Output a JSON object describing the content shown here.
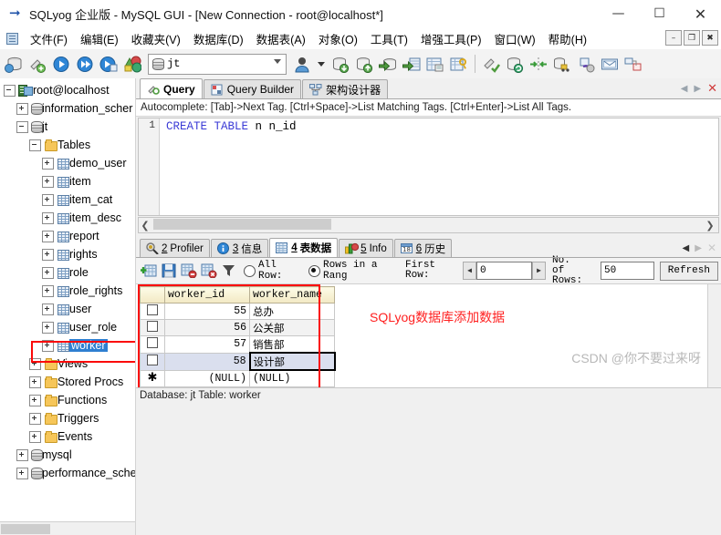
{
  "window": {
    "title": "SQLyog 企业版 - MySQL GUI - [New Connection - root@localhost*]",
    "app_icon": "sqlyog-icon",
    "minimize": "—",
    "maximize": "☐",
    "close": "✕",
    "mdi_minimize": "–",
    "mdi_restore": "❐",
    "mdi_close": "✖"
  },
  "menubar": {
    "items": [
      {
        "label": "文件(F)"
      },
      {
        "label": "编辑(E)"
      },
      {
        "label": "收藏夹(V)"
      },
      {
        "label": "数据库(D)"
      },
      {
        "label": "数据表(A)"
      },
      {
        "label": "对象(O)"
      },
      {
        "label": "工具(T)"
      },
      {
        "label": "增强工具(P)"
      },
      {
        "label": "窗口(W)"
      },
      {
        "label": "帮助(H)"
      }
    ]
  },
  "toolbar": {
    "database_selector": {
      "value": "jt",
      "icon": "database-icon"
    }
  },
  "sidebar": {
    "items": [
      {
        "label": "root@localhost",
        "indent": 0,
        "expander": "minus",
        "icon": "server-icon",
        "selected": false
      },
      {
        "label": "information_scher",
        "indent": 1,
        "expander": "plus",
        "icon": "database-icon",
        "selected": false
      },
      {
        "label": "jt",
        "indent": 1,
        "expander": "minus",
        "icon": "database-icon",
        "selected": false
      },
      {
        "label": "Tables",
        "indent": 2,
        "expander": "minus",
        "icon": "folder-icon",
        "selected": false
      },
      {
        "label": "demo_user",
        "indent": 3,
        "expander": "plus",
        "icon": "table-icon",
        "selected": false
      },
      {
        "label": "item",
        "indent": 3,
        "expander": "plus",
        "icon": "table-icon",
        "selected": false
      },
      {
        "label": "item_cat",
        "indent": 3,
        "expander": "plus",
        "icon": "table-icon",
        "selected": false
      },
      {
        "label": "item_desc",
        "indent": 3,
        "expander": "plus",
        "icon": "table-icon",
        "selected": false
      },
      {
        "label": "report",
        "indent": 3,
        "expander": "plus",
        "icon": "table-icon",
        "selected": false
      },
      {
        "label": "rights",
        "indent": 3,
        "expander": "plus",
        "icon": "table-icon",
        "selected": false
      },
      {
        "label": "role",
        "indent": 3,
        "expander": "plus",
        "icon": "table-icon",
        "selected": false
      },
      {
        "label": "role_rights",
        "indent": 3,
        "expander": "plus",
        "icon": "table-icon",
        "selected": false
      },
      {
        "label": "user",
        "indent": 3,
        "expander": "plus",
        "icon": "table-icon",
        "selected": false
      },
      {
        "label": "user_role",
        "indent": 3,
        "expander": "plus",
        "icon": "table-icon",
        "selected": false
      },
      {
        "label": "worker",
        "indent": 3,
        "expander": "plus",
        "icon": "table-icon",
        "selected": true
      },
      {
        "label": "Views",
        "indent": 2,
        "expander": "plus",
        "icon": "folder-icon",
        "selected": false
      },
      {
        "label": "Stored Procs",
        "indent": 2,
        "expander": "plus",
        "icon": "folder-icon",
        "selected": false
      },
      {
        "label": "Functions",
        "indent": 2,
        "expander": "plus",
        "icon": "folder-icon",
        "selected": false
      },
      {
        "label": "Triggers",
        "indent": 2,
        "expander": "plus",
        "icon": "folder-icon",
        "selected": false
      },
      {
        "label": "Events",
        "indent": 2,
        "expander": "plus",
        "icon": "folder-icon",
        "selected": false
      },
      {
        "label": "mysql",
        "indent": 1,
        "expander": "plus",
        "icon": "database-icon",
        "selected": false
      },
      {
        "label": "performance_sche",
        "indent": 1,
        "expander": "plus",
        "icon": "database-icon",
        "selected": false
      }
    ]
  },
  "query_tabs": {
    "tabs": [
      {
        "label": "Query",
        "icon": "query-icon",
        "active": true
      },
      {
        "label": "Query Builder",
        "icon": "query-builder-icon",
        "active": false
      },
      {
        "label": "架构设计器",
        "icon": "schema-designer-icon",
        "active": false
      }
    ],
    "close_label": "✕"
  },
  "editor": {
    "autocomplete_hint": "Autocomplete: [Tab]->Next Tag. [Ctrl+Space]->List Matching Tags. [Ctrl+Enter]->List All Tags.",
    "line_number": "1",
    "code_keyword": "CREATE TABLE",
    "code_rest": " n n_id"
  },
  "result_tabs": {
    "tabs": [
      {
        "num": "2",
        "label": "Profiler",
        "icon": "profiler-icon",
        "active": false
      },
      {
        "num": "3",
        "label": "信息",
        "icon": "info-blue-icon",
        "active": false
      },
      {
        "num": "4",
        "label": "表数据",
        "icon": "table-data-icon",
        "active": true
      },
      {
        "num": "5",
        "label": "Info",
        "icon": "chart-icon",
        "active": false
      },
      {
        "num": "6",
        "label": "历史",
        "icon": "calendar-icon",
        "active": false
      }
    ]
  },
  "grid_toolbar": {
    "icons": [
      {
        "name": "new-row-icon"
      },
      {
        "name": "save-icon"
      },
      {
        "name": "delete-row-icon"
      },
      {
        "name": "discard-changes-icon"
      },
      {
        "name": "filter-icon"
      }
    ],
    "all_rows_label": "All Row:",
    "range_label": "Rows in a Rang",
    "first_row_label_1": "First",
    "first_row_label_2": "Row:",
    "first_row_value": "0",
    "no_of_rows_label_1": "No. of",
    "no_of_rows_label_2": "Rows:",
    "no_of_rows_value": "50",
    "refresh_label": "Refresh",
    "selected_mode": "range"
  },
  "data_grid": {
    "columns": [
      "worker_id",
      "worker_name"
    ],
    "rows": [
      {
        "marker": "checkbox",
        "worker_id": "55",
        "worker_name": "总办",
        "selected": false
      },
      {
        "marker": "checkbox",
        "worker_id": "56",
        "worker_name": "公关部",
        "selected": false
      },
      {
        "marker": "checkbox",
        "worker_id": "57",
        "worker_name": "销售部",
        "selected": false
      },
      {
        "marker": "checkbox",
        "worker_id": "58",
        "worker_name": "设计部",
        "selected": true
      },
      {
        "marker": "star",
        "worker_id": "(NULL)",
        "worker_name": "(NULL)",
        "selected": false
      }
    ]
  },
  "annotation": {
    "text": "SQLyog数据库添加数据",
    "color": "#ff2020"
  },
  "watermark": {
    "text": "CSDN @你不要过来呀",
    "color": "#b8b8b8"
  },
  "statusbar": {
    "text": "Database: jt Table: worker"
  }
}
